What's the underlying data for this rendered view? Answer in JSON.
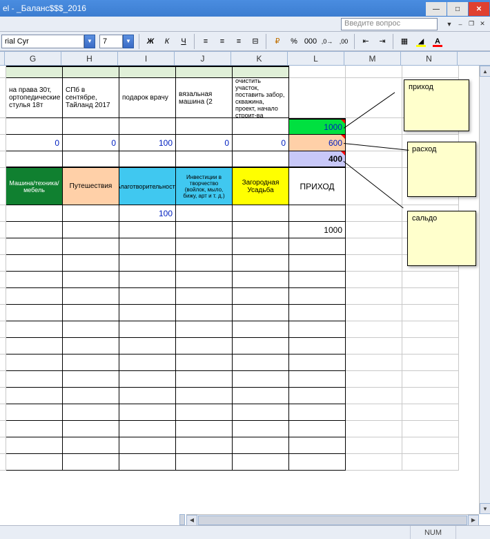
{
  "window": {
    "title": "el - _Баланс$$$_2016",
    "ask_placeholder": "Введите вопрос"
  },
  "toolbar": {
    "font_name": "rial Cyr",
    "font_size": "7"
  },
  "columns": [
    "G",
    "H",
    "I",
    "J",
    "K",
    "L",
    "M",
    "N"
  ],
  "row_notes": {
    "g": "на права 30т, ортопедические стулья 18т",
    "h": "СПб в сентябре, Тайланд 2017",
    "i": "подарок врачу",
    "j": "вязальная машина (2",
    "k": "очистить участок, поставить забор, скважина, проект, начало строит-ва"
  },
  "values": {
    "l_green": "1000",
    "g_zero": "0",
    "h_zero": "0",
    "i_hundred": "100",
    "j_zero": "0",
    "k_zero": "0",
    "l_peach": "600",
    "l_lav": "400",
    "i_hundred2": "100",
    "l_thousand": "1000"
  },
  "headers": {
    "g": "Машина/техника/мебель",
    "h": "Путешествия",
    "i": "Благотворительность",
    "j": "Инвестиции в творчество (войлок, мыло, бижу, арт и т. д.)",
    "k": "Загородная Усадьба",
    "l": "ПРИХОД"
  },
  "notes": {
    "n1": "приход",
    "n2": "расход",
    "n3": "сальдо"
  },
  "status": {
    "num": "NUM"
  },
  "chart_data": {
    "type": "table",
    "title": "_Баланс$$$_2016",
    "columns_shown": [
      "G",
      "H",
      "I",
      "J",
      "K",
      "L"
    ],
    "rows": [
      {
        "kind": "description",
        "G": "на права 30т, ортопедические стулья 18т",
        "H": "СПб в сентябре, Тайланд 2017",
        "I": "подарок врачу",
        "J": "вязальная машина (2",
        "K": "очистить участок, поставить забор, скважина, проект, начало строит-ва",
        "L": ""
      },
      {
        "kind": "приход",
        "L": 1000,
        "fill": "#00e040"
      },
      {
        "kind": "расход",
        "G": 0,
        "H": 0,
        "I": 100,
        "J": 0,
        "K": 0,
        "L": 600,
        "fill": "#ffd0a8"
      },
      {
        "kind": "сальдо",
        "L": 400,
        "fill": "#c8c8f8"
      },
      {
        "kind": "category_header",
        "G": "Машина/техника/мебель",
        "H": "Путешествия",
        "I": "Благотворительность",
        "J": "Инвестиции в творчество (войлок, мыло, бижу, арт и т. д.)",
        "K": "Загородная Усадьба",
        "L": "ПРИХОД"
      },
      {
        "kind": "detail",
        "I": 100
      },
      {
        "kind": "detail",
        "L": 1000
      }
    ],
    "comments": [
      {
        "cell": "L (green row)",
        "text": "приход"
      },
      {
        "cell": "L (peach row)",
        "text": "расход"
      },
      {
        "cell": "L (lavender row)",
        "text": "сальдо"
      }
    ]
  }
}
